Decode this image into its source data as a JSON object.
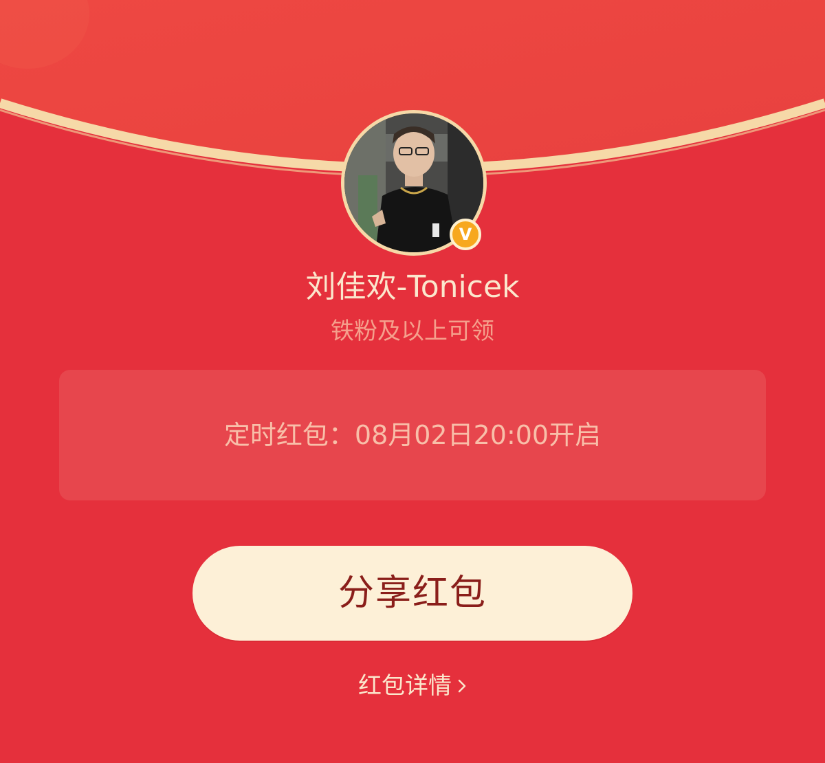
{
  "envelope": {
    "sender_name": "刘佳欢-Tonicek",
    "verified_badge": "V",
    "requirement": "铁粉及以上可领",
    "scheduled_notice": "定时红包：08月02日20:00开启",
    "share_label": "分享红包",
    "details_label": "红包详情"
  },
  "icons": {
    "verified": "verified-v-icon",
    "details_arrow": "chevron-right-icon"
  },
  "colors": {
    "background": "#e5303c",
    "flap": "#ec4a44",
    "flap_rim": "#f6d9a8",
    "button_bg": "#fdf0d7",
    "button_text": "#8a1e1a",
    "badge": "#f7a81f"
  }
}
